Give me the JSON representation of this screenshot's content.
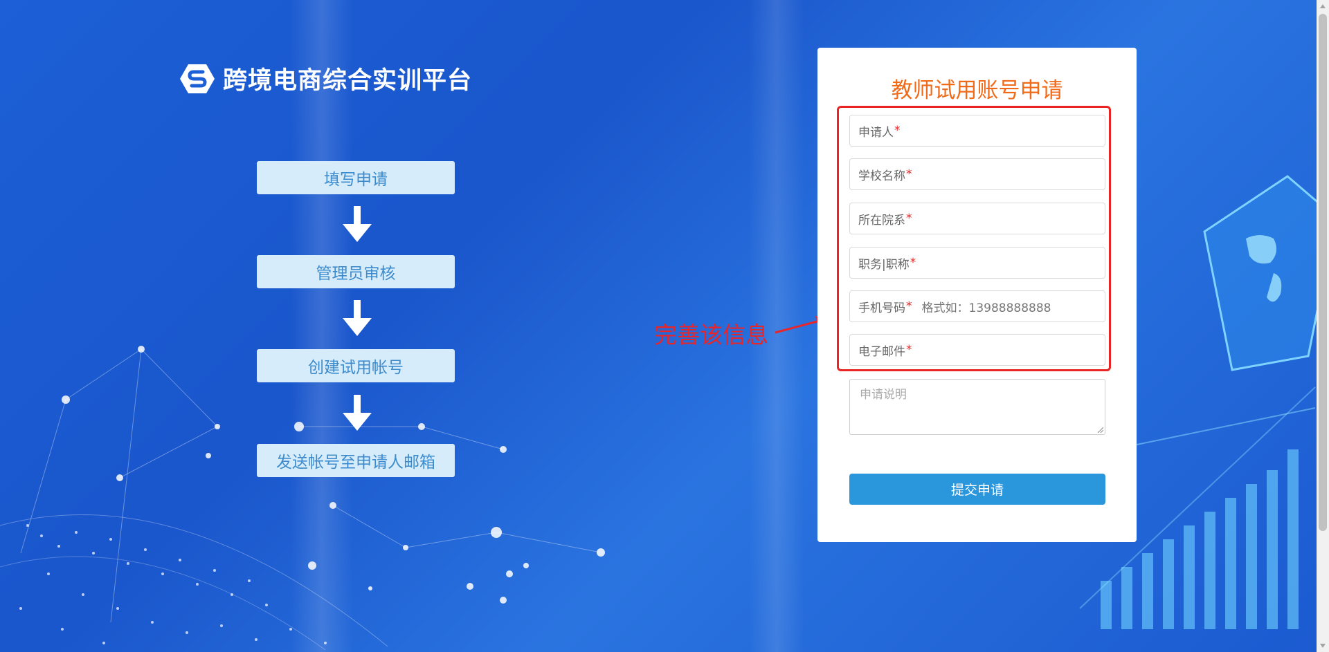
{
  "app": {
    "title": "跨境电商综合实训平台"
  },
  "flow": {
    "steps": [
      {
        "label": "填写申请"
      },
      {
        "label": "管理员审核"
      },
      {
        "label": "创建试用帐号"
      },
      {
        "label": "发送帐号至申请人邮箱"
      }
    ]
  },
  "annotation": {
    "text": "完善该信息"
  },
  "form": {
    "title": "教师试用账号申请",
    "required_mark": "*",
    "fields": [
      {
        "label": "申请人"
      },
      {
        "label": "学校名称"
      },
      {
        "label": "所在院系"
      },
      {
        "label": "职务|职称"
      },
      {
        "label": "手机号码",
        "hint": "格式如：13988888888"
      },
      {
        "label": "电子邮件"
      }
    ],
    "description_placeholder": "申请说明",
    "submit_label": "提交申请"
  },
  "colors": {
    "background": "#1c5fd6",
    "step_bg": "#d6ecfb",
    "step_text": "#3d8bcc",
    "form_title": "#f06a18",
    "highlight": "#ea2424",
    "required": "#e22222",
    "submit_bg": "#2a96dc"
  },
  "icons": {
    "logo": "s-logo-icon",
    "flow_arrow": "arrow-down-icon",
    "annotation_arrow": "arrow-right-icon"
  }
}
